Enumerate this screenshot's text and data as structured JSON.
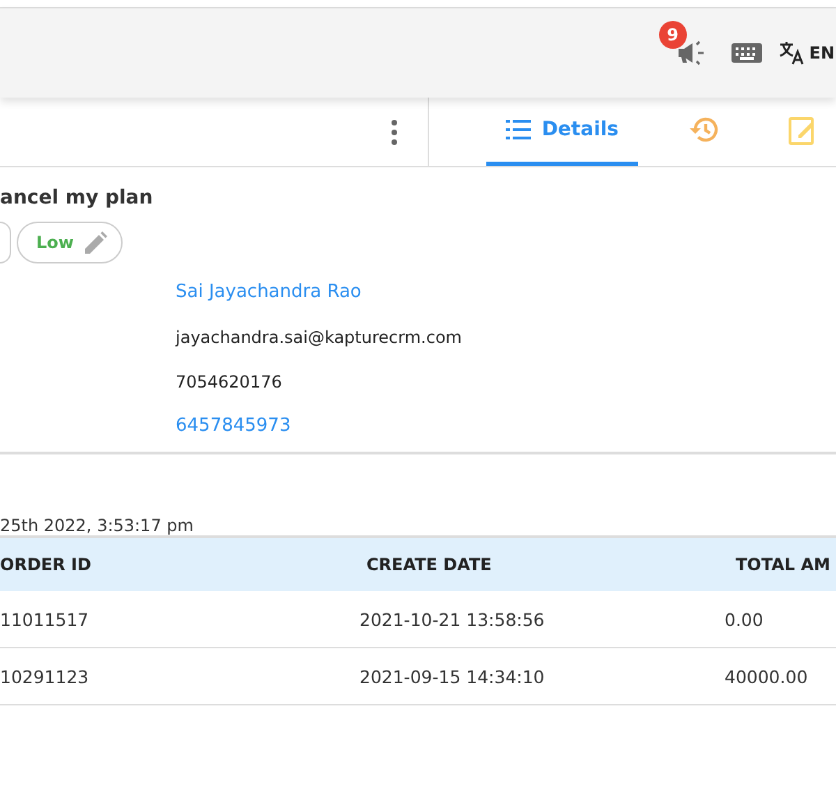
{
  "header": {
    "notification_count": "9",
    "language": "EN"
  },
  "tabs": [
    {
      "kind": "details",
      "label": "Details",
      "selected": true
    },
    {
      "kind": "history",
      "selected": false
    },
    {
      "kind": "notes",
      "selected": false
    }
  ],
  "ticket": {
    "title": "ancel my plan",
    "priority": "Low"
  },
  "contact": {
    "name": "Sai Jayachandra Rao",
    "email": "jayachandra.sai@kapturecrm.com",
    "phone": "7054620176",
    "alt_phone": "6457845973"
  },
  "created": "25th 2022, 3:53:17 pm",
  "orders": {
    "columns": [
      "ORDER ID",
      "CREATE DATE",
      "TOTAL AM"
    ],
    "rows": [
      [
        "11011517",
        "2021-10-21 13:58:56",
        "0.00"
      ],
      [
        "10291123",
        "2021-09-15 14:34:10",
        "40000.00"
      ]
    ]
  }
}
